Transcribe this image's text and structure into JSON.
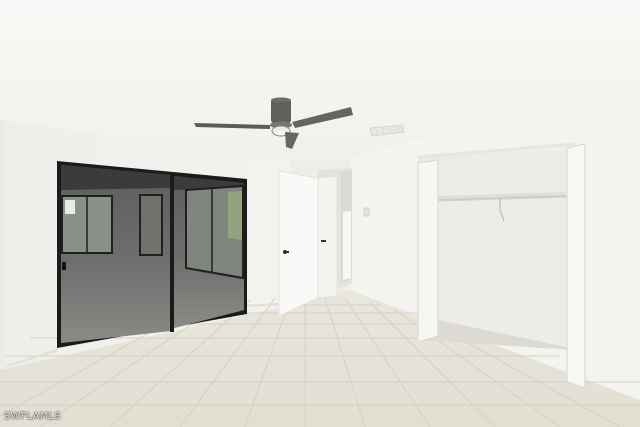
{
  "photo": {
    "watermark": "SWFLAMLS"
  },
  "colors": {
    "wall": "#f1f1ee",
    "ceiling": "#f6f6f3",
    "floor_tile": "#e6e3d9",
    "grout": "#d2cec2",
    "mirror_frame": "#1d1d1d",
    "fan_body": "#5e5e5b"
  },
  "icons": {
    "ceiling_fan": "ceiling-fan-icon",
    "ac_vent": "vent-icon",
    "light_switch": "switch-icon"
  }
}
